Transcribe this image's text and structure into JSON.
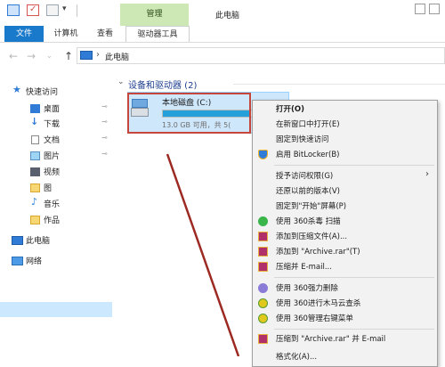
{
  "titlebar": {
    "context_tab": "管理",
    "window_title": "此电脑",
    "quick_access_dropdown": "▾"
  },
  "ribbon": {
    "tabs": [
      {
        "label": "文件"
      },
      {
        "label": "计算机"
      },
      {
        "label": "查看"
      },
      {
        "label": "驱动器工具"
      }
    ]
  },
  "address": {
    "path_separator": "›",
    "path": "此电脑",
    "nav_icons": [
      "back-arrow-icon",
      "forward-arrow-icon",
      "recent-dropdown-icon",
      "up-arrow-icon"
    ]
  },
  "sidebar": {
    "items": [
      {
        "label": "快速访问",
        "icon": "star-icon"
      },
      {
        "label": "桌面",
        "icon": "desktop-icon",
        "pinned": true
      },
      {
        "label": "下载",
        "icon": "download-icon",
        "pinned": true
      },
      {
        "label": "文档",
        "icon": "document-icon",
        "pinned": true
      },
      {
        "label": "图片",
        "icon": "picture-icon",
        "pinned": true
      },
      {
        "label": "视频",
        "icon": "video-icon"
      },
      {
        "label": "图",
        "icon": "folder-icon"
      },
      {
        "label": "音乐",
        "icon": "music-icon"
      },
      {
        "label": "作品",
        "icon": "folder-icon"
      },
      {
        "label": "此电脑",
        "icon": "computer-icon",
        "selected": true
      },
      {
        "label": "网络",
        "icon": "network-icon"
      }
    ],
    "pin_glyph": "⊸"
  },
  "content": {
    "group_header": "设备和驱动器 (2)",
    "group_chevron": "⌄",
    "drive": {
      "name": "本地磁盘 (C:)",
      "space_text": "13.0 GB 可用，共 5(",
      "usage_fraction": 0.72
    },
    "drive2_faint": "..."
  },
  "context_menu": {
    "items": [
      {
        "label": "打开(O)",
        "bold": true
      },
      {
        "label": "在新窗口中打开(E)"
      },
      {
        "label": "固定到快速访问"
      },
      {
        "label": "启用 BitLocker(B)",
        "icon": "shield-icon"
      },
      {
        "separator": true
      },
      {
        "label": "授予访问权限(G)",
        "submenu": true
      },
      {
        "label": "还原以前的版本(V)"
      },
      {
        "label": "固定到\"开始\"屏幕(P)"
      },
      {
        "label": "使用 360杀毒 扫描",
        "icon": "360-antivirus-icon"
      },
      {
        "label": "添加到压缩文件(A)...",
        "icon": "winrar-icon"
      },
      {
        "label": "添加到 \"Archive.rar\"(T)",
        "icon": "winrar-icon"
      },
      {
        "label": "压缩并 E-mail...",
        "icon": "winrar-icon"
      },
      {
        "separator": true
      },
      {
        "label": "使用 360强力删除",
        "icon": "360-delete-icon"
      },
      {
        "label": "使用 360进行木马云查杀",
        "icon": "360-trojan-icon"
      },
      {
        "label": "使用 360管理右键菜单",
        "icon": "360-menu-icon"
      },
      {
        "separator": true
      },
      {
        "label": "压缩到 \"Archive.rar\" 并 E-mail",
        "icon": "winrar-icon"
      },
      {
        "label": "格式化(A)..."
      }
    ],
    "submenu_arrow": "›"
  },
  "colors": {
    "file_tab": "#1979ca",
    "context_tab_bg": "#cde8b4",
    "selection": "#cce8ff",
    "highlight_box": "#c6453c",
    "drive_bar": "#26a0da"
  }
}
